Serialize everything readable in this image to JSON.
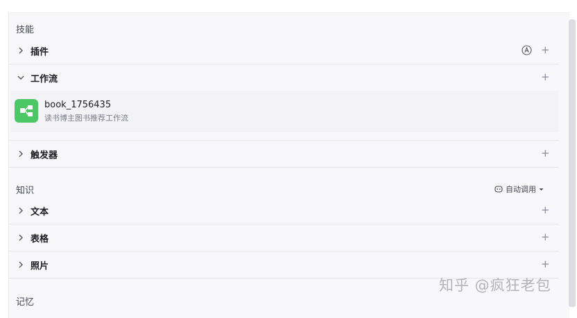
{
  "skills": {
    "title": "技能",
    "plugin_label": "插件",
    "workflow_label": "工作流",
    "trigger_label": "触发器",
    "workflow_item": {
      "name": "book_1756435",
      "description": "读书博主图书推荐工作流"
    }
  },
  "knowledge": {
    "title": "知识",
    "auto_call": "自动调用",
    "text_label": "文本",
    "table_label": "表格",
    "photo_label": "照片"
  },
  "memory": {
    "title": "记忆"
  },
  "watermark": "知乎 @疯狂老包",
  "colors": {
    "workflow_icon_bg": "#4cc766",
    "panel_bg": "#f8f8fb"
  }
}
